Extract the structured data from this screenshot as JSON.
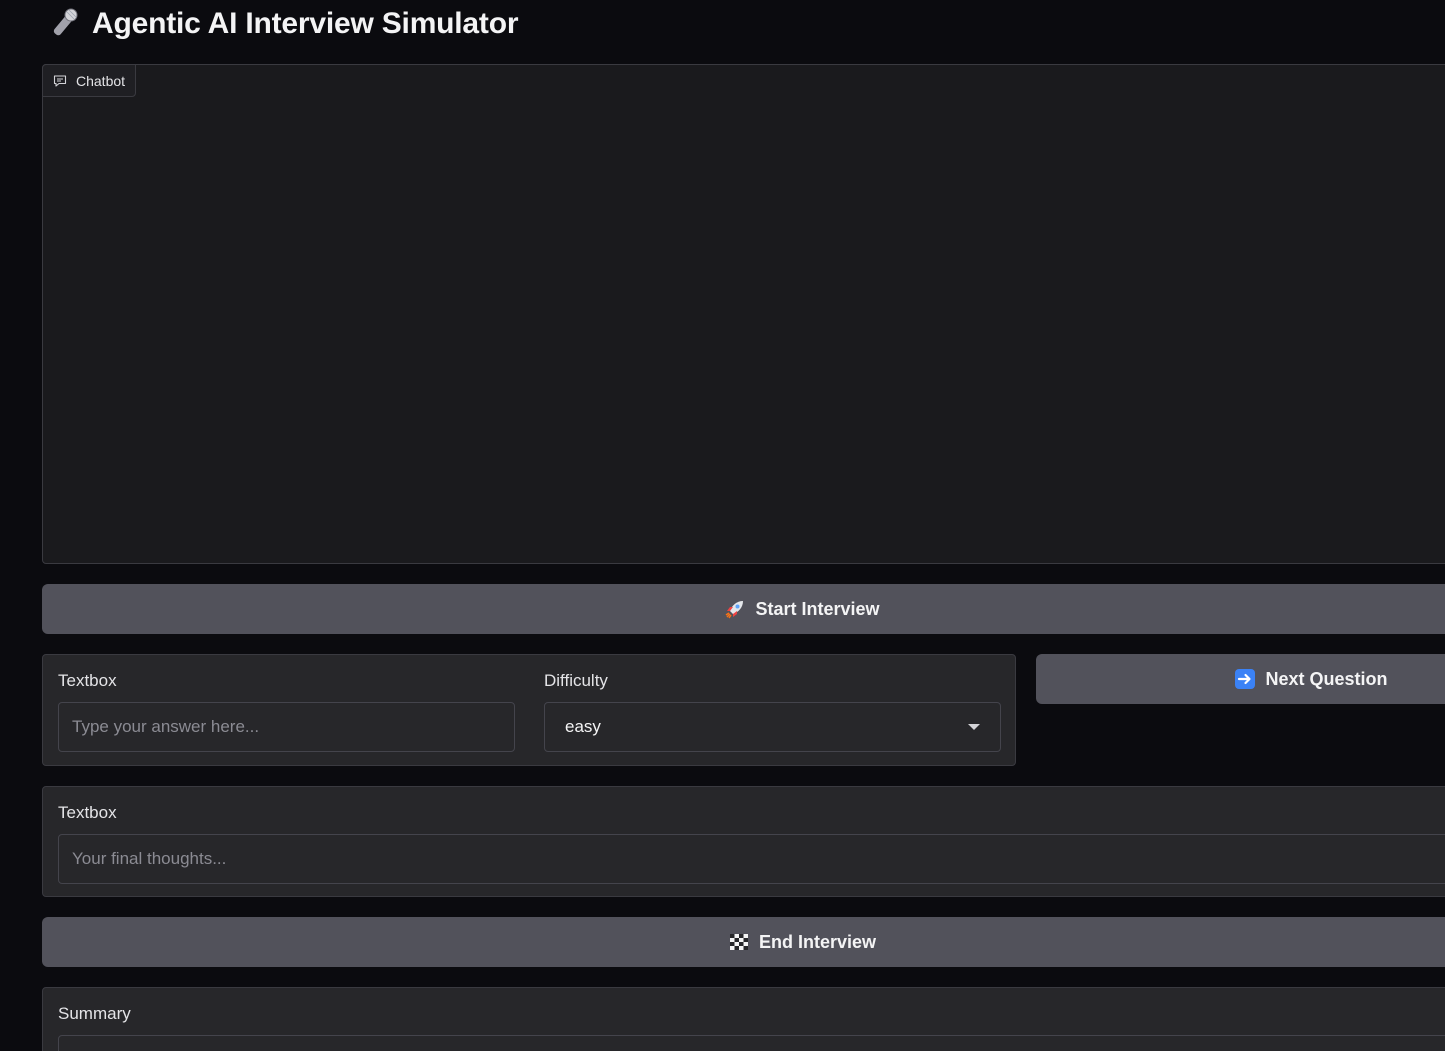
{
  "app": {
    "title": "Agentic AI Interview Simulator",
    "title_icon": "microphone-icon"
  },
  "chatbot": {
    "label": "Chatbot",
    "label_icon": "chat-bubble-icon"
  },
  "buttons": {
    "start": {
      "label": "Start Interview",
      "icon": "rocket-icon"
    },
    "next": {
      "label": "Next Question",
      "icon": "right-arrow-icon"
    },
    "end": {
      "label": "End Interview",
      "icon": "checkered-flag-icon"
    }
  },
  "answer": {
    "label": "Textbox",
    "value": "",
    "placeholder": "Type your answer here..."
  },
  "difficulty": {
    "label": "Difficulty",
    "selected": "easy"
  },
  "final_thoughts": {
    "label": "Textbox",
    "value": "",
    "placeholder": "Your final thoughts..."
  },
  "summary": {
    "label": "Summary"
  },
  "colors": {
    "background": "#0b0b0f",
    "panel": "#27272a",
    "button": "#52525b",
    "chatbot_bg": "#1a1a1d"
  }
}
